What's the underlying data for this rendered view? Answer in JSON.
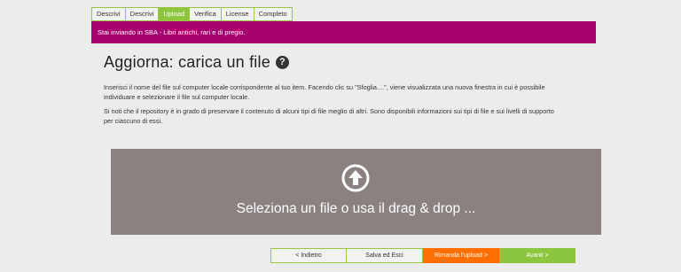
{
  "tabs": [
    {
      "label": "Descrivi",
      "active": false
    },
    {
      "label": "Descrivi",
      "active": false
    },
    {
      "label": "Upload",
      "active": true
    },
    {
      "label": "Verifica",
      "active": false
    },
    {
      "label": "License",
      "active": false
    },
    {
      "label": "Completo",
      "active": false
    }
  ],
  "banner": {
    "text": "Stai inviando in SBA - Libri antichi, rari e di pregio."
  },
  "page": {
    "title": "Aggiorna: carica un file",
    "help_icon": "question-circle-icon",
    "paragraph1": "Inserisci il nome del file sul computer locale corrispondente al tuo item. Facendo clic su \"Sfoglia....\", viene visualizzata una nuova finestra in cui è possibile individuare e selezionare il file sul computer locale.",
    "paragraph2": "Si noti che il repository è in grado di preservare il contenuto di alcuni tipi di file meglio di altri. Sono disponibili informazioni sui tipi di file e sui livelli di supporto per ciascuno di essi."
  },
  "dropzone": {
    "icon": "upload-arrow-icon",
    "text": "Seleziona un file o usa il drag & drop ..."
  },
  "buttons": {
    "back": "< Indietro",
    "save": "Salva ed Esci",
    "cancel": "Rimanda l'upload >",
    "next": "Avanti >"
  },
  "colors": {
    "accent_green": "#8cc63f",
    "banner_magenta": "#a6006e",
    "orange": "#ff6e00",
    "dropzone_gray": "#8a8180"
  }
}
